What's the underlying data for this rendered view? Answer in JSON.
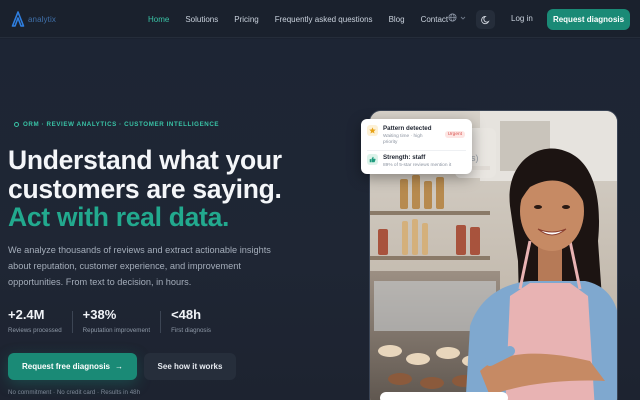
{
  "brand": {
    "logo_text": "analytix",
    "accent": "#39c3a6",
    "cta_color": "#1a8a76"
  },
  "nav": {
    "links": [
      {
        "label": "Home",
        "active": true
      },
      {
        "label": "Solutions",
        "active": false
      },
      {
        "label": "Pricing",
        "active": false
      },
      {
        "label": "Frequently asked questions",
        "active": false
      },
      {
        "label": "Blog",
        "active": false
      },
      {
        "label": "Contact",
        "active": false
      }
    ],
    "language_icon": "globe-icon",
    "theme_icon": "moon-icon",
    "login_label": "Log in",
    "cta_label": "Request diagnosis"
  },
  "hero": {
    "eyebrow": "ORM · REVIEW ANALYTICS · CUSTOMER INTELLIGENCE",
    "headline_line1": "Understand what your",
    "headline_line2": "customers are saying.",
    "headline_accent": "Act with real data.",
    "subtitle": "We analyze thousands of reviews and extract actionable insights about reputation, customer experience, and improvement opportunities. From text to decision, in hours.",
    "stats": [
      {
        "value": "+2.4M",
        "label": "Reviews processed"
      },
      {
        "value": "+38%",
        "label": "Reputation improvement"
      },
      {
        "value": "<48h",
        "label": "First diagnosis"
      }
    ],
    "cta_primary": "Request free diagnosis",
    "cta_primary_arrow": "→",
    "cta_secondary": "See how it works",
    "fineprint": "No commitment · No credit card · Results in 48h"
  },
  "notification": {
    "items": [
      {
        "icon": "star-icon",
        "title": "Pattern detected",
        "desc_line1": "Waiting time · high",
        "desc_line2": "priority",
        "badge": "Urgent"
      },
      {
        "icon": "thumbs-up-icon",
        "title": "Strength: staff",
        "desc_line1": "89% of 5-star reviews mention it"
      }
    ]
  },
  "ghost_card": {
    "text": "s)"
  }
}
